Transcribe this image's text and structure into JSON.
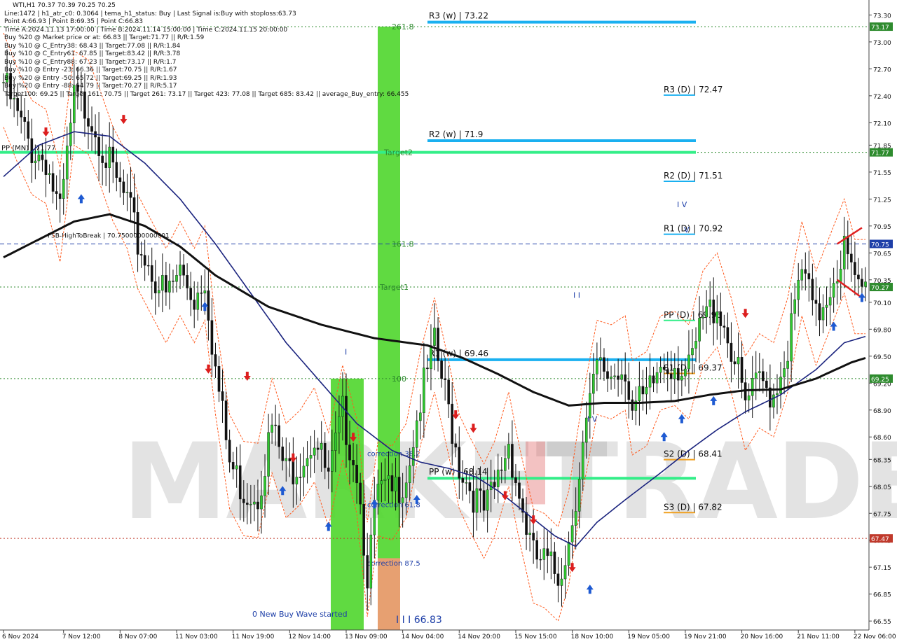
{
  "chart_data": {
    "type": "candlestick",
    "symbol": "WTI,H1",
    "header_ohlc": "WTI,H1  70.37 70.39 70.25 70.25",
    "info_lines": [
      "Line:1472 | h1_atr_c0: 0.3064 | tema_h1_status: Buy | Last Signal is:Buy with stoploss:63.73",
      "Point A:66.93 | Point B:69.35 | Point C:66.83",
      "Time A:2024.11.13 17:00:00 | Time B:2024.11.14 15:00:00 | Time C:2024.11.15 20:00:00",
      "Buy %20 @ Market price or at: 66.83 || Target:71.77 || R/R:1.59",
      "Buy %10 @ C_Entry38: 68.43 || Target:77.08 || R/R:1.84",
      "Buy %10 @ C_Entry61: 67.85 || Target:83.42 || R/R:3.78",
      "Buy %10 @ C_Entry88: 67.23 || Target:73.17 || R/R:1.7",
      "Buy %10 @ Entry -23: 66.36 || Target:70.75 || R/R:1.67",
      "Buy %20 @ Entry -50: 65.72 || Target:69.25 || R/R:1.93",
      "Buy %20 @ Entry -88: 64.79 || Target:70.27 || R/R:5.17",
      "Target100: 69.25 || Target 161: 70.75 || Target 261: 73.17 || Target 423: 77.08 || Target 685: 83.42 || average_Buy_entry: 66.455"
    ],
    "y_ticks": [
      "73.30",
      "73.00",
      "72.70",
      "72.40",
      "72.10",
      "71.85",
      "71.55",
      "71.25",
      "70.95",
      "70.65",
      "70.35",
      "70.10",
      "69.80",
      "69.50",
      "69.20",
      "68.90",
      "68.60",
      "68.35",
      "68.05",
      "67.75",
      "67.45",
      "67.15",
      "66.85",
      "66.55"
    ],
    "y_tick_values": [
      73.3,
      73.0,
      72.7,
      72.4,
      72.1,
      71.85,
      71.55,
      71.25,
      70.95,
      70.65,
      70.35,
      70.1,
      69.8,
      69.5,
      69.2,
      68.9,
      68.6,
      68.35,
      68.05,
      67.75,
      67.45,
      67.15,
      66.85,
      66.55
    ],
    "ylim": [
      66.45,
      73.42
    ],
    "x_labels": [
      "6 Nov 2024",
      "7 Nov 12:00",
      "8 Nov 07:00",
      "11 Nov 03:00",
      "11 Nov 19:00",
      "12 Nov 14:00",
      "13 Nov 09:00",
      "14 Nov 04:00",
      "14 Nov 20:00",
      "15 Nov 15:00",
      "18 Nov 10:00",
      "19 Nov 05:00",
      "19 Nov 21:00",
      "20 Nov 16:00",
      "21 Nov 11:00",
      "22 Nov 06:00"
    ],
    "x_label_bars": [
      0,
      17,
      33,
      49,
      65,
      81,
      97,
      113,
      129,
      145,
      161,
      177,
      193,
      209,
      225,
      241
    ],
    "bar_count": 245,
    "price_tags": [
      {
        "value": 73.17,
        "text": "73.17",
        "color": "#2e8b2e"
      },
      {
        "value": 71.77,
        "text": "71.77",
        "color": "#2e8b2e"
      },
      {
        "value": 70.75,
        "text": "70.75",
        "color": "#1e3fa8"
      },
      {
        "value": 70.27,
        "text": "70.27",
        "color": "#2e8b2e"
      },
      {
        "value": 69.25,
        "text": "69.25",
        "color": "#2e8b2e"
      },
      {
        "value": 67.47,
        "text": "67.47",
        "color": "#c0392b"
      }
    ],
    "h_lines": [
      {
        "value": 73.17,
        "style": "dotted",
        "color": "#2e8b2e"
      },
      {
        "value": 71.77,
        "style": "dotted",
        "color": "#2e8b2e"
      },
      {
        "value": 70.75,
        "style": "dashed",
        "color": "#1e3fa8"
      },
      {
        "value": 70.27,
        "style": "dotted",
        "color": "#2e8b2e"
      },
      {
        "value": 69.25,
        "style": "dotted",
        "color": "#2e8b2e"
      },
      {
        "value": 67.47,
        "style": "dotted",
        "color": "#c0392b"
      }
    ],
    "weekly_pivots": [
      {
        "text": "R3 (w) | 73.22",
        "value": 73.22,
        "color": "#1ab0f0"
      },
      {
        "text": "R2 (w) | 71.9",
        "value": 71.9,
        "color": "#1ab0f0"
      },
      {
        "text": "R1 (w) | 69.46",
        "value": 69.46,
        "color": "#1ab0f0"
      },
      {
        "text": "PP (w) | 68.14",
        "value": 68.14,
        "color": "#33ee88"
      }
    ],
    "daily_pivots": [
      {
        "text": "R3 (D) | 72.47",
        "value": 72.47,
        "color": "#1ab0f0"
      },
      {
        "text": "R2 (D) | 71.51",
        "value": 71.51,
        "color": "#1ab0f0"
      },
      {
        "text": "R1 (D) | 70.92",
        "value": 70.92,
        "color": "#1ab0f0"
      },
      {
        "text": "PP (D) | 69.96",
        "value": 69.96,
        "color": "#33ee88"
      },
      {
        "text": "S1 (D) | 69.37",
        "value": 69.37,
        "color": "#f0a020"
      },
      {
        "text": "S2 (D) | 68.41",
        "value": 68.41,
        "color": "#f0a020"
      },
      {
        "text": "S3 (D) | 67.82",
        "value": 67.82,
        "color": "#f0a020"
      }
    ],
    "target_line": {
      "value": 71.77,
      "label": "Target2",
      "color": "#33ee88"
    },
    "monthly_pp": {
      "text": "PP (MN) | 71.77"
    },
    "fsb_label": "FSB-HighToBreak | 70.7500000000001",
    "fib_labels": [
      {
        "text": "261.8",
        "value": 73.17
      },
      {
        "text": "161.8",
        "value": 70.75
      },
      {
        "text": "Target1",
        "value": 70.27
      },
      {
        "text": "100",
        "value": 69.25
      }
    ],
    "correction_labels": [
      {
        "text": "correction 38.2",
        "value": 68.42
      },
      {
        "text": "correction 61.8",
        "value": 67.85
      },
      {
        "text": "correction 87.5",
        "value": 67.2
      }
    ],
    "wave_labels": [
      {
        "text": "0 New Buy Wave started",
        "value": 66.63
      },
      {
        "text": "I I I 66.83",
        "value": 66.56
      },
      {
        "text": "I",
        "value": 69.55
      },
      {
        "text": "I I",
        "value": 70.18
      },
      {
        "text": "I V",
        "value": 68.8
      },
      {
        "text": "I V",
        "value": 71.19
      },
      {
        "text": "V",
        "value": 70.91
      }
    ],
    "watermark": {
      "text_left": "MARKET",
      "text_right": "TRADE"
    },
    "colors": {
      "bull": "#2ec82e",
      "bear": "#111111",
      "ema_fast": "#1a237e",
      "ema_slow": "#111111",
      "channel": "#ff5a1e",
      "buy_arrow": "#1e5ad2",
      "sell_arrow": "#dc1e1e"
    },
    "price_path": [
      [
        0,
        72.55
      ],
      [
        4,
        72.15
      ],
      [
        8,
        71.8
      ],
      [
        12,
        71.7
      ],
      [
        16,
        71.05
      ],
      [
        20,
        72.35
      ],
      [
        24,
        72.25
      ],
      [
        27,
        71.95
      ],
      [
        31,
        71.5
      ],
      [
        35,
        71.2
      ],
      [
        38,
        70.75
      ],
      [
        42,
        70.45
      ],
      [
        46,
        70.15
      ],
      [
        50,
        70.45
      ],
      [
        54,
        70.15
      ],
      [
        57,
        70.4
      ],
      [
        60,
        69.35
      ],
      [
        64,
        68.3
      ],
      [
        68,
        68.0
      ],
      [
        72,
        67.98
      ],
      [
        76,
        68.7
      ],
      [
        80,
        68.2
      ],
      [
        84,
        68.35
      ],
      [
        88,
        68.6
      ],
      [
        92,
        68.1
      ],
      [
        96,
        68.85
      ],
      [
        100,
        68.25
      ],
      [
        103,
        67.1
      ],
      [
        106,
        68.0
      ],
      [
        110,
        67.95
      ],
      [
        114,
        68.2
      ],
      [
        118,
        69.0
      ],
      [
        122,
        69.6
      ],
      [
        126,
        68.9
      ],
      [
        129,
        68.3
      ],
      [
        132,
        68.05
      ],
      [
        136,
        67.75
      ],
      [
        139,
        68.0
      ],
      [
        143,
        68.55
      ],
      [
        146,
        67.95
      ],
      [
        150,
        67.25
      ],
      [
        153,
        67.2
      ],
      [
        157,
        67.05
      ],
      [
        160,
        67.45
      ],
      [
        164,
        68.5
      ],
      [
        168,
        69.35
      ],
      [
        172,
        69.3
      ],
      [
        176,
        69.4
      ],
      [
        178,
        68.9
      ],
      [
        182,
        69.0
      ],
      [
        186,
        69.4
      ],
      [
        190,
        69.45
      ],
      [
        194,
        69.3
      ],
      [
        198,
        69.9
      ],
      [
        202,
        70.1
      ],
      [
        206,
        69.6
      ],
      [
        210,
        68.95
      ],
      [
        214,
        69.2
      ],
      [
        218,
        69.1
      ],
      [
        222,
        69.6
      ],
      [
        226,
        70.45
      ],
      [
        230,
        69.9
      ],
      [
        234,
        70.3
      ],
      [
        238,
        70.7
      ],
      [
        241,
        70.25
      ],
      [
        244,
        70.25
      ]
    ],
    "ema_slow_path": [
      [
        0,
        70.6
      ],
      [
        10,
        70.8
      ],
      [
        20,
        71.0
      ],
      [
        30,
        71.08
      ],
      [
        40,
        70.95
      ],
      [
        50,
        70.72
      ],
      [
        60,
        70.4
      ],
      [
        75,
        70.05
      ],
      [
        90,
        69.85
      ],
      [
        105,
        69.7
      ],
      [
        120,
        69.62
      ],
      [
        130,
        69.48
      ],
      [
        140,
        69.3
      ],
      [
        150,
        69.1
      ],
      [
        160,
        68.95
      ],
      [
        170,
        68.98
      ],
      [
        180,
        68.98
      ],
      [
        190,
        69.0
      ],
      [
        200,
        69.07
      ],
      [
        210,
        69.12
      ],
      [
        220,
        69.13
      ],
      [
        230,
        69.25
      ],
      [
        240,
        69.43
      ],
      [
        244,
        69.48
      ]
    ],
    "ema_fast_path": [
      [
        0,
        71.5
      ],
      [
        10,
        71.85
      ],
      [
        20,
        72.0
      ],
      [
        30,
        71.95
      ],
      [
        40,
        71.65
      ],
      [
        50,
        71.25
      ],
      [
        60,
        70.75
      ],
      [
        70,
        70.2
      ],
      [
        80,
        69.65
      ],
      [
        90,
        69.2
      ],
      [
        100,
        68.75
      ],
      [
        110,
        68.45
      ],
      [
        118,
        68.32
      ],
      [
        126,
        68.25
      ],
      [
        134,
        68.15
      ],
      [
        140,
        68.0
      ],
      [
        148,
        67.75
      ],
      [
        156,
        67.5
      ],
      [
        162,
        67.38
      ],
      [
        168,
        67.65
      ],
      [
        176,
        67.9
      ],
      [
        186,
        68.2
      ],
      [
        194,
        68.45
      ],
      [
        202,
        68.68
      ],
      [
        210,
        68.88
      ],
      [
        220,
        69.07
      ],
      [
        230,
        69.35
      ],
      [
        238,
        69.65
      ],
      [
        244,
        69.72
      ]
    ],
    "signals": [
      {
        "bar": 12,
        "value": 72.0,
        "dir": "sell"
      },
      {
        "bar": 34,
        "value": 72.14,
        "dir": "sell"
      },
      {
        "bar": 57,
        "value": 70.05,
        "dir": "buy"
      },
      {
        "bar": 58,
        "value": 69.36,
        "dir": "sell"
      },
      {
        "bar": 69,
        "value": 69.28,
        "dir": "sell"
      },
      {
        "bar": 82,
        "value": 68.37,
        "dir": "sell"
      },
      {
        "bar": 79,
        "value": 68.0,
        "dir": "buy"
      },
      {
        "bar": 92,
        "value": 67.6,
        "dir": "buy"
      },
      {
        "bar": 99,
        "value": 68.6,
        "dir": "sell"
      },
      {
        "bar": 105,
        "value": 67.85,
        "dir": "buy"
      },
      {
        "bar": 117,
        "value": 67.9,
        "dir": "buy"
      },
      {
        "bar": 128,
        "value": 68.85,
        "dir": "sell"
      },
      {
        "bar": 133,
        "value": 68.7,
        "dir": "sell"
      },
      {
        "bar": 142,
        "value": 67.95,
        "dir": "sell"
      },
      {
        "bar": 150,
        "value": 67.68,
        "dir": "sell"
      },
      {
        "bar": 161,
        "value": 67.15,
        "dir": "sell"
      },
      {
        "bar": 166,
        "value": 66.9,
        "dir": "buy"
      },
      {
        "bar": 187,
        "value": 68.6,
        "dir": "buy"
      },
      {
        "bar": 192,
        "value": 68.8,
        "dir": "buy"
      },
      {
        "bar": 201,
        "value": 69.0,
        "dir": "buy"
      },
      {
        "bar": 210,
        "value": 69.98,
        "dir": "sell"
      },
      {
        "bar": 235,
        "value": 69.83,
        "dir": "buy"
      },
      {
        "bar": 243,
        "value": 70.15,
        "dir": "buy"
      },
      {
        "bar": 22,
        "value": 71.25,
        "dir": "buy"
      }
    ]
  }
}
